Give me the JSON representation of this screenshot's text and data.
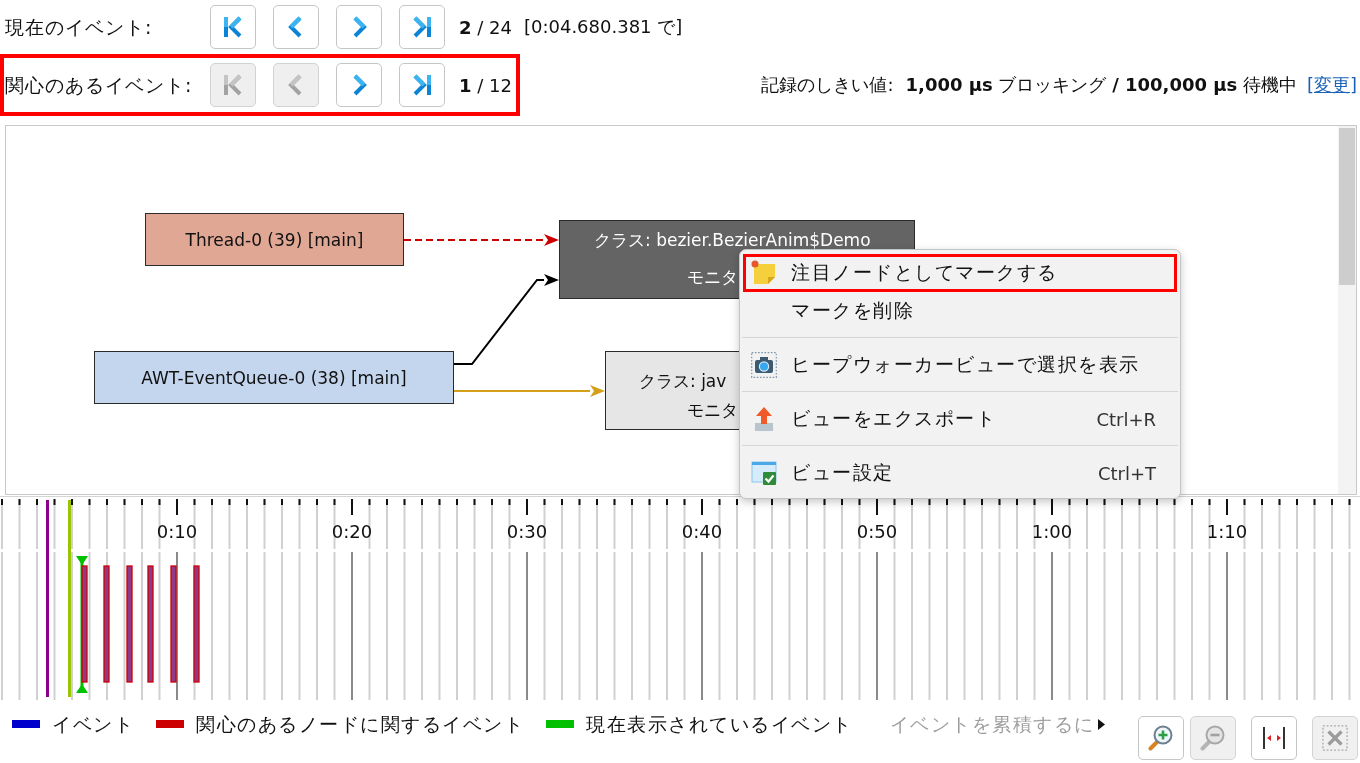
{
  "navigation": [
    {
      "label": "現在のイベント:",
      "outlined": false,
      "buttons": [
        {
          "kind": "first",
          "disabled": false
        },
        {
          "kind": "previous",
          "disabled": false
        },
        {
          "kind": "next",
          "disabled": false
        },
        {
          "kind": "last",
          "disabled": false
        }
      ],
      "counter": "**2** / 24",
      "time": "[0:04.680.381 で]"
    },
    {
      "label": "関心のあるイベント:",
      "outlined": true,
      "buttons": [
        {
          "kind": "first",
          "disabled": true
        },
        {
          "kind": "previous",
          "disabled": true
        },
        {
          "kind": "next",
          "disabled": false
        },
        {
          "kind": "last",
          "disabled": false
        }
      ],
      "counter": "**1** / 12"
    }
  ],
  "threshold": {
    "label": "記録のしきい値:",
    "value": "**1,000 µs** ブロッキング **/ 100,000 µs** 待機中",
    "link": "[変更]"
  },
  "graph": {
    "nodes": [
      {
        "kind": "thread",
        "selected": false,
        "color": "#e0a794",
        "lines": [
          "Thread-0 (39) [main]"
        ]
      },
      {
        "kind": "monitor",
        "selected": true,
        "lines": [
          "クラス: bezier.BezierAnim$Demo",
          "モニタ"
        ]
      },
      {
        "kind": "thread",
        "selected": false,
        "color": "#c4d5ee",
        "lines": [
          "AWT-EventQueue-0 (38) [main]"
        ]
      },
      {
        "kind": "monitor",
        "selected": false,
        "lines": [
          "クラス: jav",
          "モニタ"
        ]
      }
    ],
    "edges": [
      {
        "kind": "dashed",
        "color": "#cc0000"
      },
      {
        "kind": "solid",
        "color": "#000000"
      },
      {
        "kind": "solid",
        "color": "#d4a017"
      }
    ]
  },
  "context_menu": {
    "groups": [
      [
        {
          "kind": "mark",
          "label": "注目ノードとしてマークする",
          "outlined": true
        },
        {
          "kind": "unmark",
          "label": "マークを削除",
          "outlined": false
        }
      ],
      [
        {
          "kind": "heap-walker",
          "label": "ヒープウォーカービューで選択を表示",
          "outlined": false
        }
      ],
      [
        {
          "kind": "export",
          "label": "ビューをエクスポート",
          "shortcut": "Ctrl+R",
          "outlined": false
        }
      ],
      [
        {
          "kind": "settings",
          "label": "ビュー設定",
          "shortcut": "Ctrl+T",
          "outlined": false
        }
      ]
    ]
  },
  "timeline": {
    "time_labels": [
      "0:10",
      "0:20",
      "0:30",
      "0:40",
      "0:50",
      "1:00",
      "1:10"
    ]
  },
  "legend": [
    {
      "label": "イベント",
      "color": "#0000cc"
    },
    {
      "label": "関心のあるノードに関するイベント",
      "color": "#cc0000"
    },
    {
      "label": "現在表示されているイベント",
      "color": "#00c000"
    }
  ],
  "hint": "イベントを累積するに",
  "tools": [
    {
      "kind": "zoom-in",
      "disabled": false
    },
    {
      "kind": "zoom-out",
      "disabled": true
    },
    {
      "kind": "fit",
      "disabled": false
    },
    {
      "kind": "close",
      "disabled": true
    }
  ]
}
